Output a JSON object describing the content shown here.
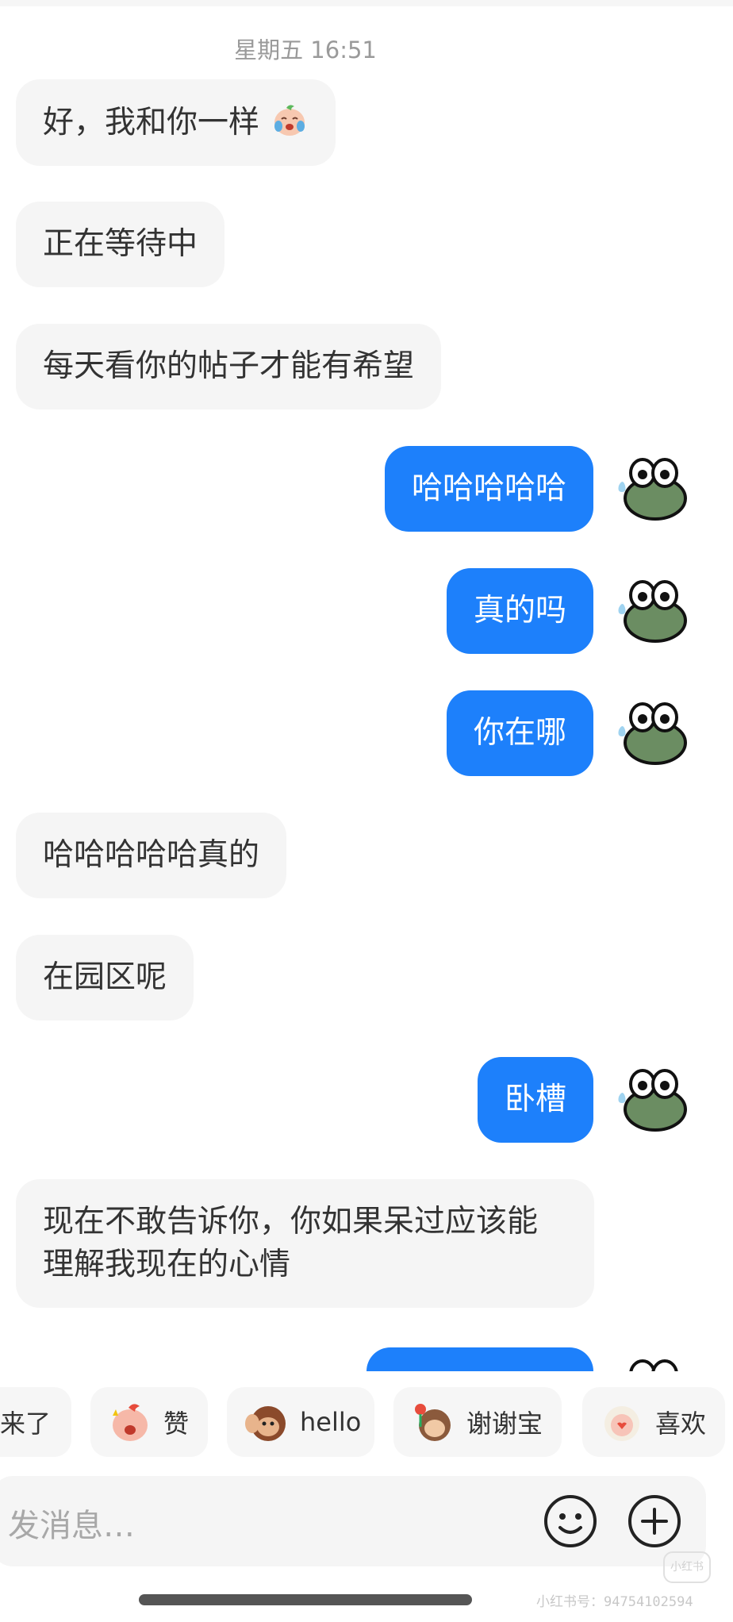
{
  "chat": {
    "timestamp": "星期五 16:51",
    "messages": [
      {
        "side": "in",
        "text": "好，我和你一样"
      },
      {
        "side": "in",
        "text": "正在等待中"
      },
      {
        "side": "in",
        "text": "每天看你的帖子才能有希望"
      },
      {
        "side": "out",
        "text": "哈哈哈哈哈"
      },
      {
        "side": "out",
        "text": "真的吗"
      },
      {
        "side": "out",
        "text": "你在哪"
      },
      {
        "side": "in",
        "text": "哈哈哈哈哈真的"
      },
      {
        "side": "in",
        "text": "在园区呢"
      },
      {
        "side": "out",
        "text": "卧槽"
      },
      {
        "side": "in",
        "text": "现在不敢告诉你，你如果呆过应该能理解我现在的心情"
      }
    ]
  },
  "quick_replies": [
    {
      "label": "来了",
      "icon": "sticker-icon"
    },
    {
      "label": "赞",
      "icon": "thumbs-sticker-icon"
    },
    {
      "label": "hello",
      "icon": "monkey-sticker-icon"
    },
    {
      "label": "谢谢宝",
      "icon": "thanks-sticker-icon"
    },
    {
      "label": "喜欢",
      "icon": "like-sticker-icon"
    }
  ],
  "input": {
    "placeholder": "发消息…",
    "emoji_icon": "smiley-icon",
    "plus_icon": "plus-icon"
  },
  "watermark": {
    "text": "小红书号：94754102594",
    "logo": "小红书"
  },
  "colors": {
    "outgoing_bubble": "#1d80fb",
    "incoming_bubble": "#f5f5f5",
    "avatar_green": "#6b8d62"
  }
}
